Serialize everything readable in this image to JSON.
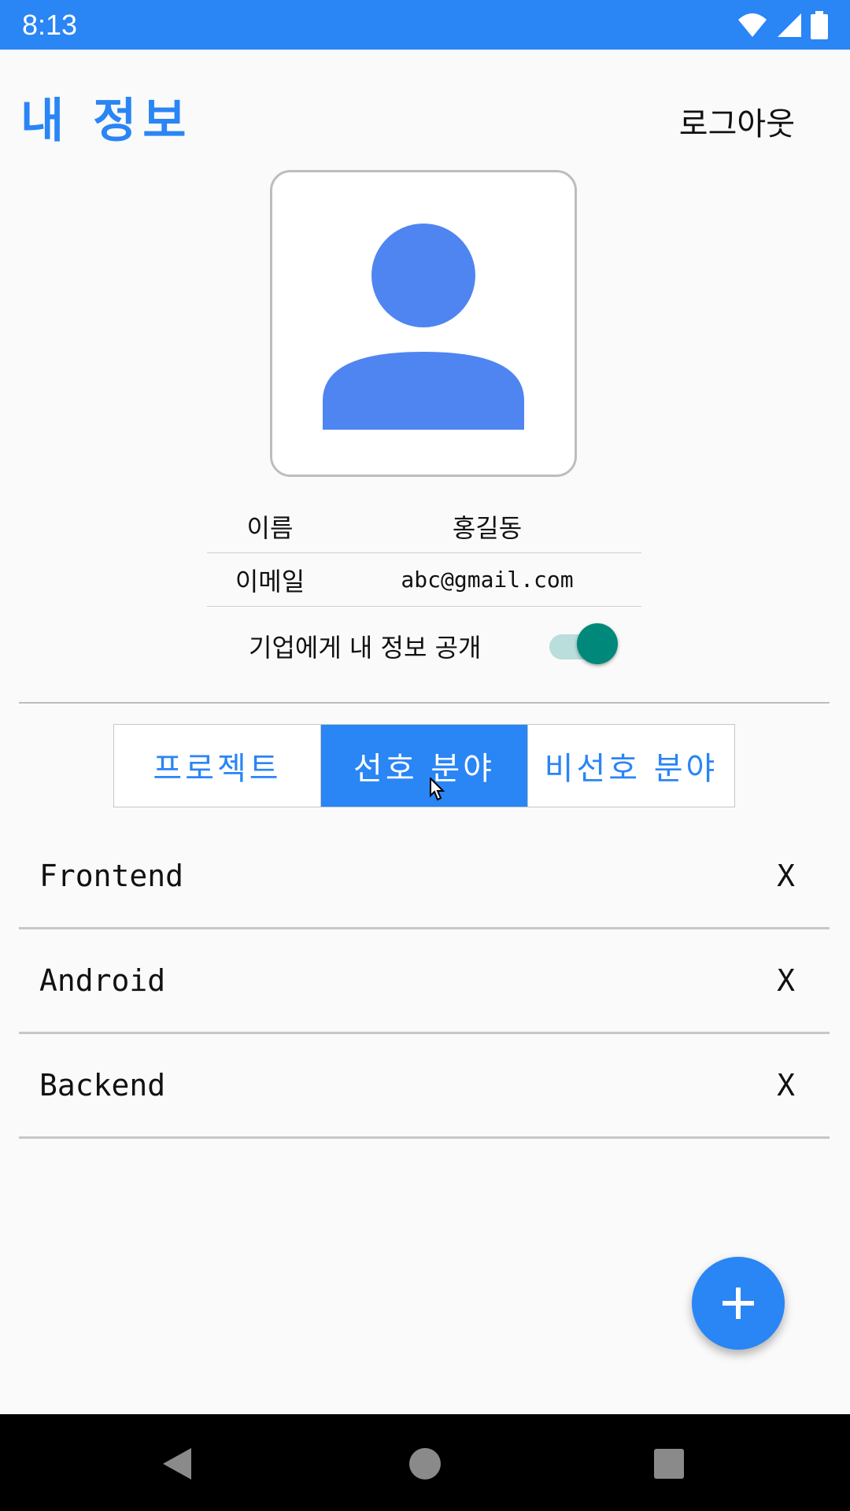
{
  "status_bar": {
    "time": "8:13"
  },
  "header": {
    "title": "내 정보",
    "logout_label": "로그아웃"
  },
  "profile": {
    "name_label": "이름",
    "name_value": "홍길동",
    "email_label": "이메일",
    "email_value": "abc@gmail.com",
    "public_toggle_label": "기업에게 내 정보 공개",
    "public_toggle_on": true
  },
  "tabs": [
    {
      "label": "프로젝트",
      "active": false
    },
    {
      "label": "선호 분야",
      "active": true
    },
    {
      "label": "비선호 분야",
      "active": false
    }
  ],
  "interests": [
    {
      "label": "Frontend",
      "remove_label": "X"
    },
    {
      "label": "Android",
      "remove_label": "X"
    },
    {
      "label": "Backend",
      "remove_label": "X"
    }
  ],
  "colors": {
    "primary": "#2a85f5",
    "toggle_thumb": "#00897b",
    "avatar_icon": "#4f85f0"
  },
  "icons": {
    "fab": "plus-icon",
    "nav": [
      "back-icon",
      "home-icon",
      "recents-icon"
    ]
  }
}
